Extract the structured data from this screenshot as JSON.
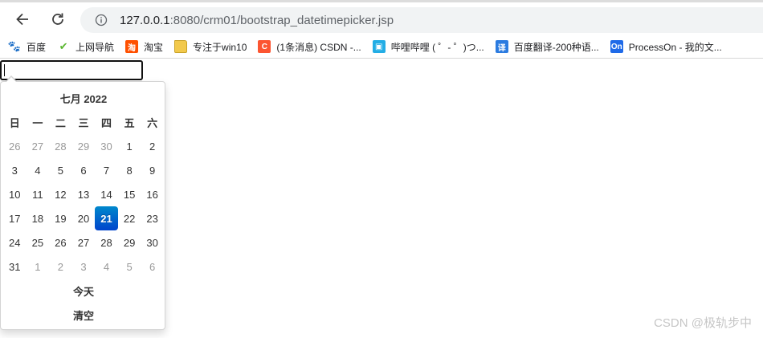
{
  "browser": {
    "url_host": "127.0.0.1",
    "url_path": ":8080/crm01/bootstrap_datetimepicker.jsp",
    "bookmarks": [
      {
        "label": "百度",
        "icon": "baidu-paw-icon",
        "color": "#2932e1"
      },
      {
        "label": "上网导航",
        "icon": "hao123-check-icon",
        "color": "#5ab630"
      },
      {
        "label": "淘宝",
        "icon": "taobao-icon",
        "color": "#ff5000"
      },
      {
        "label": "专注于win10",
        "icon": "folder-icon",
        "color": "#f2c94c"
      },
      {
        "label": "(1条消息) CSDN -...",
        "icon": "csdn-icon",
        "color": "#fc5531"
      },
      {
        "label": "哔哩哔哩 ( ゜- ゜)つ...",
        "icon": "bilibili-tv-icon",
        "color": "#23ade5"
      },
      {
        "label": "百度翻译-200种语...",
        "icon": "translate-icon",
        "color": "#2b7be0"
      },
      {
        "label": "ProcessOn - 我的文...",
        "icon": "processon-icon",
        "color": "#1f6ae8"
      }
    ]
  },
  "page": {
    "date_input_value": ""
  },
  "picker": {
    "title": "七月 2022",
    "weekdays": [
      "日",
      "一",
      "二",
      "三",
      "四",
      "五",
      "六"
    ],
    "weeks": [
      [
        {
          "d": "26",
          "other": true
        },
        {
          "d": "27",
          "other": true
        },
        {
          "d": "28",
          "other": true
        },
        {
          "d": "29",
          "other": true
        },
        {
          "d": "30",
          "other": true
        },
        {
          "d": "1"
        },
        {
          "d": "2"
        }
      ],
      [
        {
          "d": "3"
        },
        {
          "d": "4"
        },
        {
          "d": "5"
        },
        {
          "d": "6"
        },
        {
          "d": "7"
        },
        {
          "d": "8"
        },
        {
          "d": "9"
        }
      ],
      [
        {
          "d": "10"
        },
        {
          "d": "11"
        },
        {
          "d": "12"
        },
        {
          "d": "13"
        },
        {
          "d": "14"
        },
        {
          "d": "15"
        },
        {
          "d": "16"
        }
      ],
      [
        {
          "d": "17"
        },
        {
          "d": "18"
        },
        {
          "d": "19"
        },
        {
          "d": "20"
        },
        {
          "d": "21",
          "active": true
        },
        {
          "d": "22"
        },
        {
          "d": "23"
        }
      ],
      [
        {
          "d": "24"
        },
        {
          "d": "25"
        },
        {
          "d": "26"
        },
        {
          "d": "27"
        },
        {
          "d": "28"
        },
        {
          "d": "29"
        },
        {
          "d": "30"
        }
      ],
      [
        {
          "d": "31"
        },
        {
          "d": "1",
          "other": true
        },
        {
          "d": "2",
          "other": true
        },
        {
          "d": "3",
          "other": true
        },
        {
          "d": "4",
          "other": true
        },
        {
          "d": "5",
          "other": true
        },
        {
          "d": "6",
          "other": true
        }
      ]
    ],
    "today_label": "今天",
    "clear_label": "清空",
    "active_color": "#0070cc"
  },
  "watermark": "CSDN @极轨步中"
}
